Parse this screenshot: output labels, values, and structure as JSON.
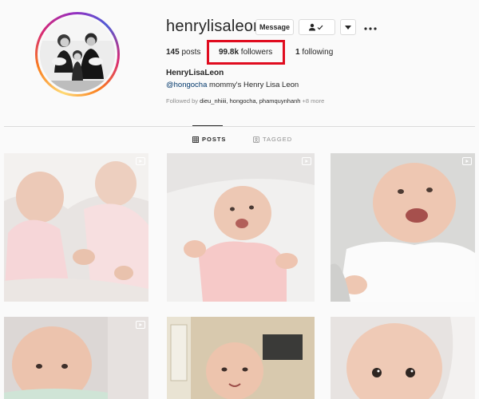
{
  "profile": {
    "username": "henrylisaleon",
    "full_name": "HenryLisaLeon",
    "bio_mention": "@hongocha",
    "bio_text": " mommy's Henry Lisa Leon",
    "followed_by_prefix": "Followed by ",
    "followed_by_names": "dieu_nhiiii, hongocha, phamquynhanh",
    "followed_by_more": " +8 more"
  },
  "actions": {
    "message_label": "Message",
    "following_icon": "person-check-icon",
    "more_icon": "chevron-down-icon",
    "options_icon": "ellipsis-icon"
  },
  "stats": {
    "posts_count": "145",
    "posts_label": " posts",
    "followers_count": "99.8k",
    "followers_label": " followers",
    "following_count": "1",
    "following_label": " following"
  },
  "tabs": {
    "posts": "POSTS",
    "tagged": "TAGGED"
  },
  "colors": {
    "highlight_box": "#e00c1f",
    "mention": "#00376b",
    "muted": "#8e8e8e"
  }
}
